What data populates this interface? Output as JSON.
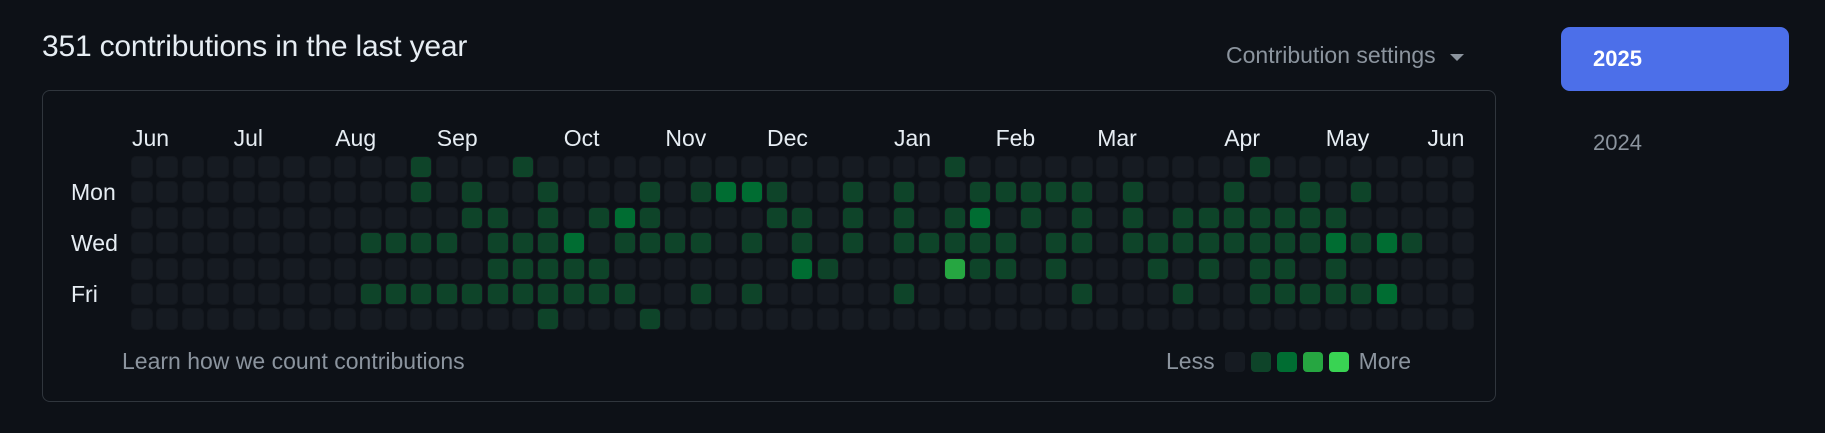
{
  "header": {
    "title": "351 contributions in the last year",
    "settings_label": "Contribution settings"
  },
  "calendar": {
    "months": [
      {
        "label": "Jun",
        "week": 0
      },
      {
        "label": "Jul",
        "week": 4
      },
      {
        "label": "Aug",
        "week": 8
      },
      {
        "label": "Sep",
        "week": 12
      },
      {
        "label": "Oct",
        "week": 17
      },
      {
        "label": "Nov",
        "week": 21
      },
      {
        "label": "Dec",
        "week": 25
      },
      {
        "label": "Jan",
        "week": 30
      },
      {
        "label": "Feb",
        "week": 34
      },
      {
        "label": "Mar",
        "week": 38
      },
      {
        "label": "Apr",
        "week": 43
      },
      {
        "label": "May",
        "week": 47
      },
      {
        "label": "Jun",
        "week": 51
      }
    ],
    "day_labels": [
      {
        "label": "Mon",
        "row": 1
      },
      {
        "label": "Wed",
        "row": 3
      },
      {
        "label": "Fri",
        "row": 5
      }
    ],
    "colors": [
      "#161b22",
      "#0e4429",
      "#006d32",
      "#26a641",
      "#39d353"
    ],
    "rows": [
      "00000000000100010000000000000000100000000000100000000",
      "00000000000101001000101221001010011111010001001010000",
      "00000000000001101012100001101010120101010111111100000",
      "00000000011110111201111010101011111011011111111212100",
      "00000000000000111110000000210000311010001010110100000",
      "00000000011111111111001010000010000001000100111112000",
      "00000000000000001000100000000000000000000000000000000"
    ]
  },
  "footer": {
    "learn_link": "Learn how we count contributions",
    "legend_less": "Less",
    "legend_more": "More"
  },
  "years": [
    {
      "label": "2025",
      "active": true
    },
    {
      "label": "2024",
      "active": false
    }
  ]
}
